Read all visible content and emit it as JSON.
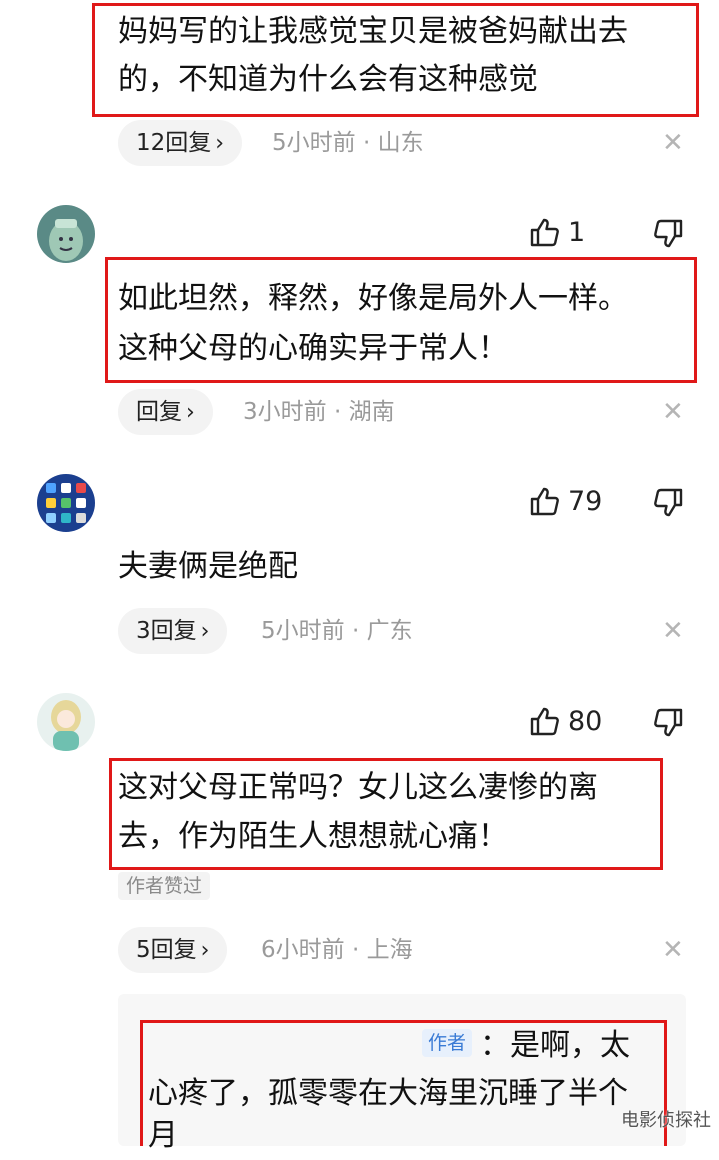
{
  "comments": [
    {
      "text_lines": [
        "妈妈写的让我感觉宝贝是被爸妈献出去",
        "的，不知道为什么会有这种感觉"
      ],
      "reply_label": "12回复",
      "meta": "5小时前 · 山东"
    },
    {
      "likes": "1",
      "text_lines": [
        "如此坦然，释然，好像是局外人一样。",
        "这种父母的心确实异于常人！"
      ],
      "reply_label": "回复",
      "meta": "3小时前 · 湖南"
    },
    {
      "likes": "79",
      "text_lines": [
        "夫妻俩是绝配"
      ],
      "reply_label": "3回复",
      "meta": "5小时前 · 广东"
    },
    {
      "likes": "80",
      "text_lines": [
        "这对父母正常吗？女儿这么凄惨的离",
        "去，作为陌生人想想就心痛！"
      ],
      "badge": "作者赞过",
      "reply_label": "5回复",
      "meta": "6小时前 · 上海"
    }
  ],
  "author_reply": {
    "author_tag": "作者",
    "text_first": "：是啊，太",
    "text_lines": [
      "心疼了，孤零零在大海里沉睡了半个",
      "月"
    ]
  },
  "watermark": "电影侦探社",
  "colors": {
    "highlight": "#e01818",
    "author_tag": "#3a7bd5"
  }
}
